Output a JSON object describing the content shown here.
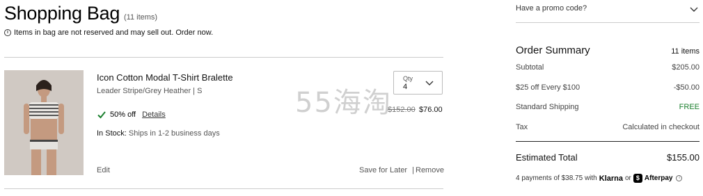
{
  "bag": {
    "title": "Shopping Bag",
    "count": "(11 items)",
    "notice": "Items in bag are not reserved and may sell out. Order now."
  },
  "item": {
    "name": "Icon Cotton Modal T-Shirt Bralette",
    "variant": "Leader Stripe/Grey Heather  |  S",
    "discount": "50% off",
    "details_link": "Details",
    "stock_label": "In Stock:",
    "stock_note": "Ships in 1-2 business days",
    "edit": "Edit",
    "qty_label": "Qty",
    "qty_value": "4",
    "price_original": "$152.00",
    "price_sale": "$76.00",
    "save_later": "Save for Later",
    "separator": "|",
    "remove": "Remove"
  },
  "watermark": "55海淘",
  "summary": {
    "promo_question": "Have a promo code?",
    "title": "Order Summary",
    "count": "11 items",
    "rows": [
      {
        "label": "Subtotal",
        "value": "$205.00"
      },
      {
        "label": "$25 off Every $100",
        "value": "-$50.00"
      },
      {
        "label": "Standard Shipping",
        "value": "FREE"
      },
      {
        "label": "Tax",
        "value": "Calculated in checkout"
      }
    ],
    "total_label": "Estimated Total",
    "total_value": "$155.00",
    "payments_text": "4 payments of $38.75 with",
    "klarna": "Klarna",
    "or": "or",
    "afterpay_badge": "$",
    "afterpay": "Afterpay"
  },
  "colors": {
    "free_green": "#1a7f2d",
    "check_green": "#1a7f2d",
    "divider": "#cccccc"
  },
  "icons": [
    "info-icon",
    "check-icon",
    "chevron-down-icon",
    "afterpay-badge-icon"
  ]
}
